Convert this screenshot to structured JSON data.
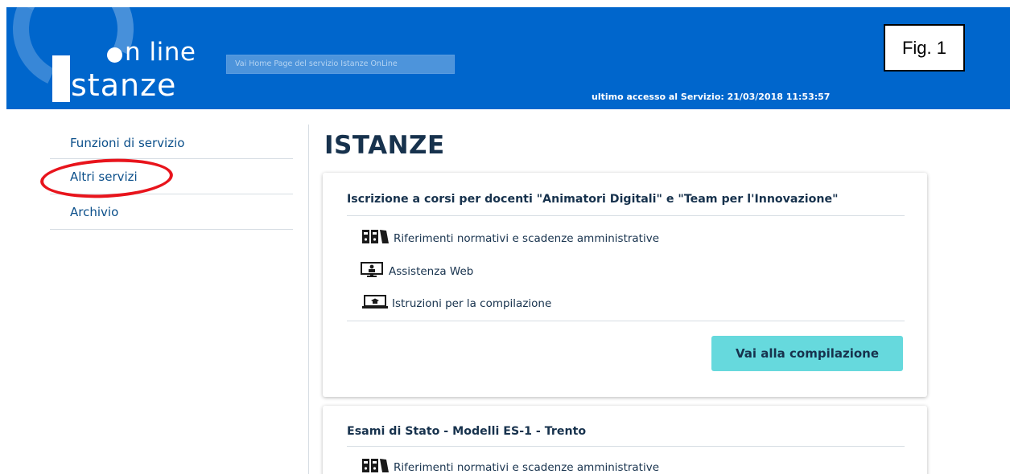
{
  "header": {
    "logo_line1": "n line",
    "logo_line2": "stanze",
    "home_link": "Vai Home Page del servizio Istanze OnLine",
    "last_access": "ultimo accesso al Servizio:  21/03/2018 11:53:57",
    "bg_color": "#0066cc"
  },
  "fig_label": "Fig. 1",
  "sidebar": {
    "items": [
      {
        "label": "Funzioni di servizio"
      },
      {
        "label": "Altri servizi"
      },
      {
        "label": "Archivio"
      }
    ],
    "highlight_color": "#e8141c"
  },
  "main": {
    "title": "ISTANZE",
    "cards": [
      {
        "title": "Iscrizione a corsi per docenti \"Animatori Digitali\" e \"Team per l'Innovazione\"",
        "links": [
          {
            "icon": "binders-icon",
            "label": "Riferimenti normativi e scadenze amministrative"
          },
          {
            "icon": "monitor-user-icon",
            "label": "Assistenza Web"
          },
          {
            "icon": "laptop-graduation-icon",
            "label": "Istruzioni per la compilazione"
          }
        ],
        "button": "Vai alla compilazione"
      },
      {
        "title": "Esami di Stato - Modelli ES-1 - Trento",
        "links": [
          {
            "icon": "binders-icon",
            "label": "Riferimenti normativi e scadenze amministrative"
          }
        ]
      }
    ],
    "button_color": "#66d9dd"
  }
}
